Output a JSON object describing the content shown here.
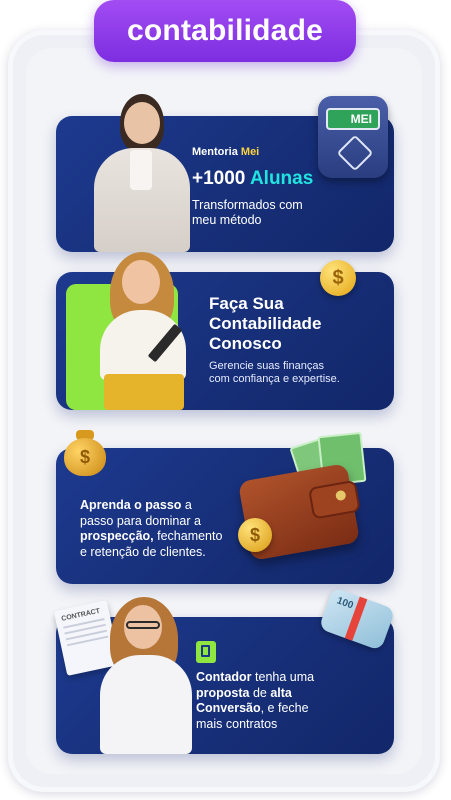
{
  "header": {
    "title": "contabilidade"
  },
  "cards": [
    {
      "eyebrow_prefix": "Mentoria",
      "eyebrow_highlight": "Mei",
      "count": "+1000",
      "count_word": "Alunas",
      "subtitle_line1": "Transformados com",
      "subtitle_line2": "meu método",
      "badge_text": "MEI"
    },
    {
      "title_line1": "Faça Sua",
      "title_line2": "Contabilidade",
      "title_line3": "Conosco",
      "desc_line1": "Gerencie suas finanças",
      "desc_line2": "com confiança e expertise.",
      "coin_symbol": "$"
    },
    {
      "line1_bold": "Aprenda o passo",
      "line1_rest": " a",
      "line2": "passo para dominar a",
      "line3_bold": "prospecção,",
      "line3_rest": " fechamento",
      "line4": "e retenção de clientes.",
      "bag_symbol": "$",
      "coin_symbol": "$"
    },
    {
      "p1": "Contador",
      "p2": " tenha uma",
      "p3": "proposta",
      "p4": " de ",
      "p5": "alta",
      "p6": "Conversão",
      "p7": ", e feche",
      "p8": "mais contratos",
      "doc_label": "CONTRACT",
      "cash_label": "100"
    }
  ],
  "colors": {
    "accent_purple": "#8a3aea",
    "card_blue": "#1b378a",
    "accent_green": "#b6ff3a",
    "accent_cyan": "#21e3e0"
  }
}
